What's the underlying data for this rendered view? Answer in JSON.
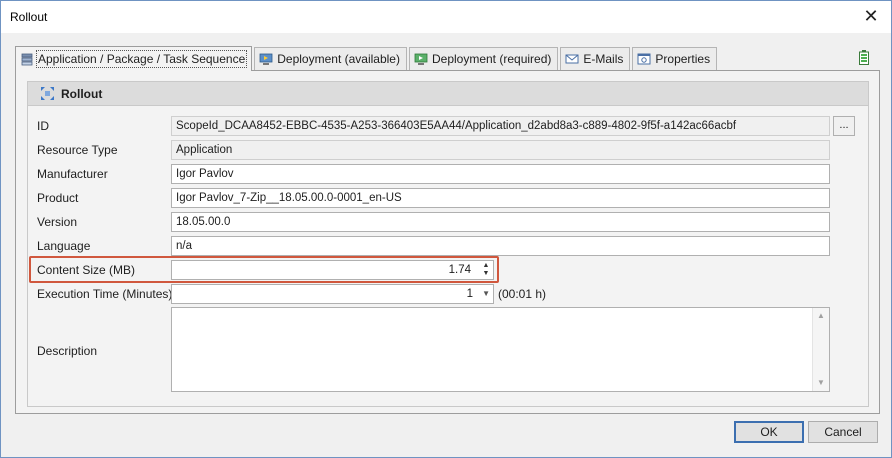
{
  "window": {
    "title": "Rollout"
  },
  "tabs": [
    {
      "label": "Application / Package / Task Sequence",
      "icon": "package-icon",
      "active": true
    },
    {
      "label": "Deployment (available)",
      "icon": "deployment-icon"
    },
    {
      "label": "Deployment (required)",
      "icon": "deployment-required-icon"
    },
    {
      "label": "E-Mails",
      "icon": "envelope-icon"
    },
    {
      "label": "Properties",
      "icon": "properties-icon"
    }
  ],
  "group": {
    "title": "Rollout",
    "icon": "rollout-icon"
  },
  "fields": {
    "id": {
      "label": "ID",
      "value": "ScopeId_DCAA8452-EBBC-4535-A253-366403E5AA44/Application_d2abd8a3-c889-4802-9f5f-a142ac66acbf",
      "button": "..."
    },
    "resource_type": {
      "label": "Resource Type",
      "value": "Application"
    },
    "manufacturer": {
      "label": "Manufacturer",
      "value": "Igor Pavlov"
    },
    "product": {
      "label": "Product",
      "value": "Igor Pavlov_7-Zip__18.05.00.0-0001_en-US"
    },
    "version": {
      "label": "Version",
      "value": "18.05.00.0"
    },
    "language": {
      "label": "Language",
      "value": "n/a"
    },
    "content_size": {
      "label": "Content Size (MB)",
      "value": "1.74"
    },
    "execution_time": {
      "label": "Execution Time (Minutes)",
      "value": "1",
      "suffix": "(00:01 h)"
    },
    "description": {
      "label": "Description",
      "value": ""
    }
  },
  "buttons": {
    "ok": "OK",
    "cancel": "Cancel"
  },
  "colors": {
    "highlight": "#d0573d",
    "accent": "#3c6fb0"
  }
}
